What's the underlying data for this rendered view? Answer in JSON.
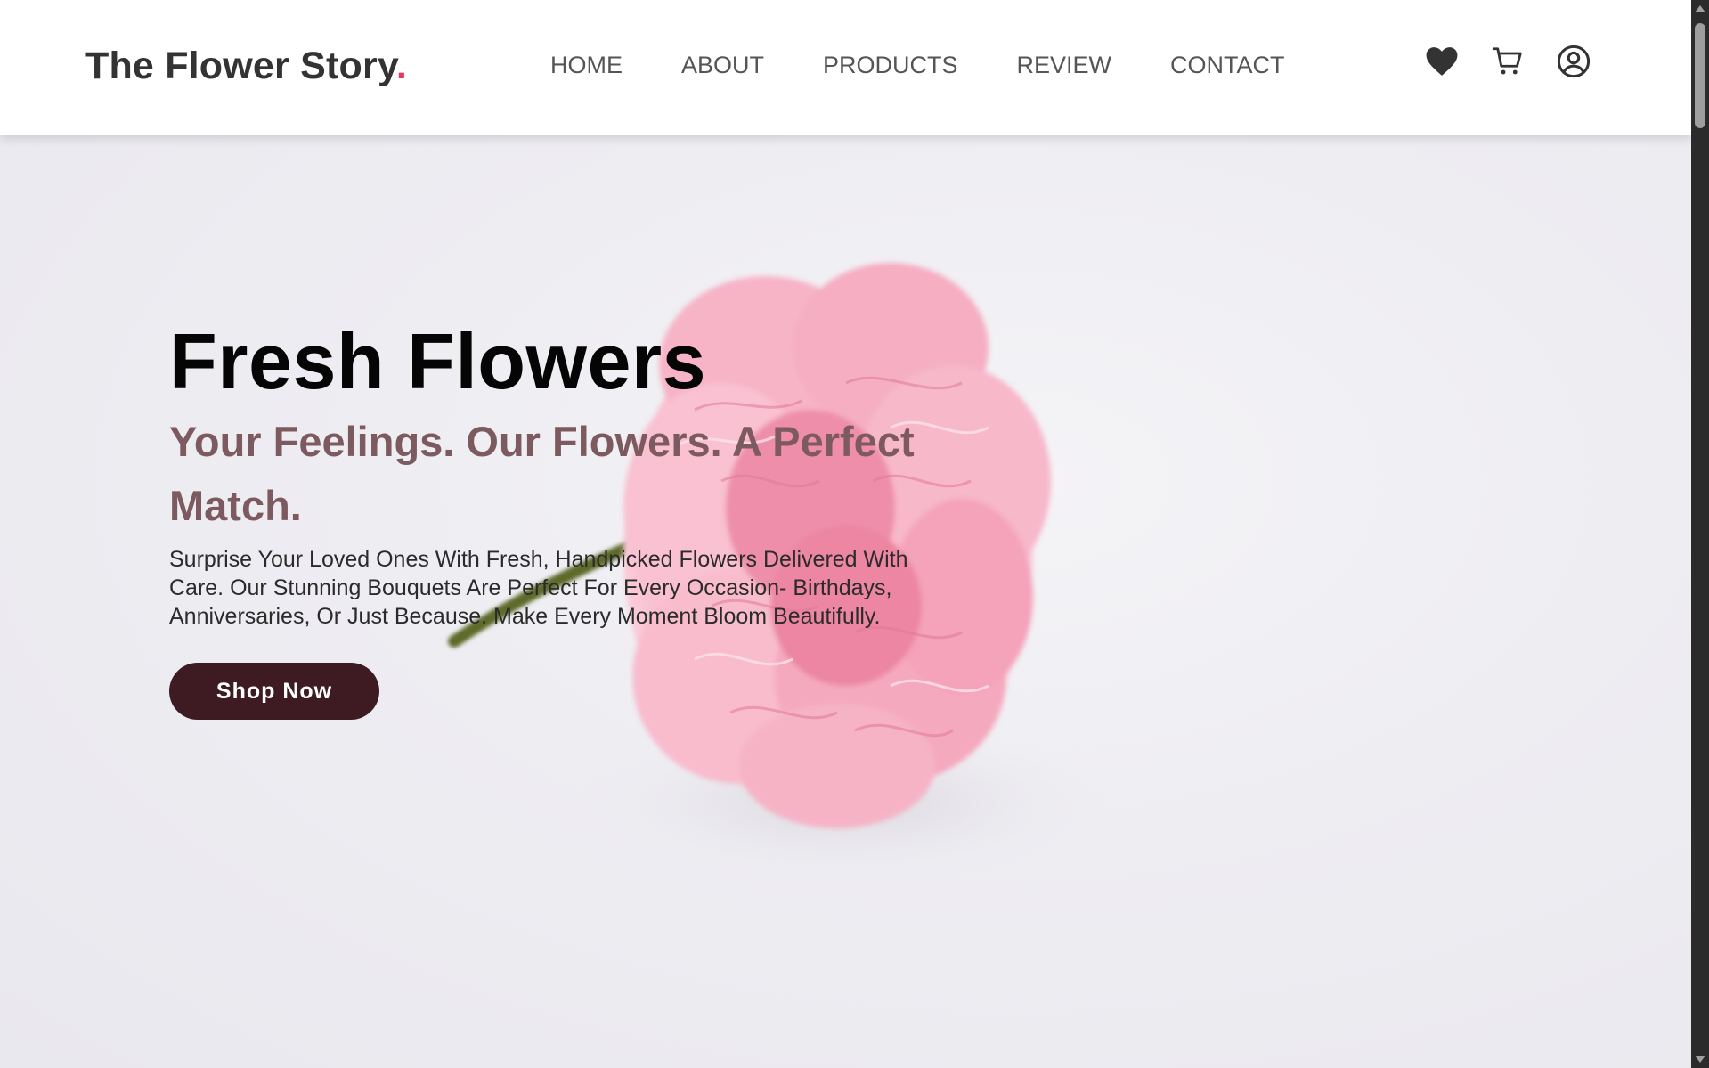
{
  "header": {
    "logo_text": "The Flower Story",
    "logo_dot": ".",
    "nav": [
      {
        "label": "HOME"
      },
      {
        "label": "ABOUT"
      },
      {
        "label": "PRODUCTS"
      },
      {
        "label": "REVIEW"
      },
      {
        "label": "CONTACT"
      }
    ],
    "icons": [
      "heart-icon",
      "cart-icon",
      "user-icon"
    ]
  },
  "hero": {
    "title": "Fresh Flowers",
    "subtitle": "Your Feelings. Our Flowers. A Perfect Match.",
    "description": "Surprise Your Loved Ones With Fresh, Handpicked Flowers Delivered With Care. Our Stunning Bouquets Are Perfect For Every Occasion- Birthdays, Anniversaries, Or Just Because. Make Every Moment Bloom Beautifully.",
    "cta_label": "Shop Now"
  },
  "colors": {
    "brand_dot": "#e8365d",
    "subtitle": "#7d5a5f",
    "cta_background": "#3e1b22",
    "header_background": "#ffffff"
  }
}
